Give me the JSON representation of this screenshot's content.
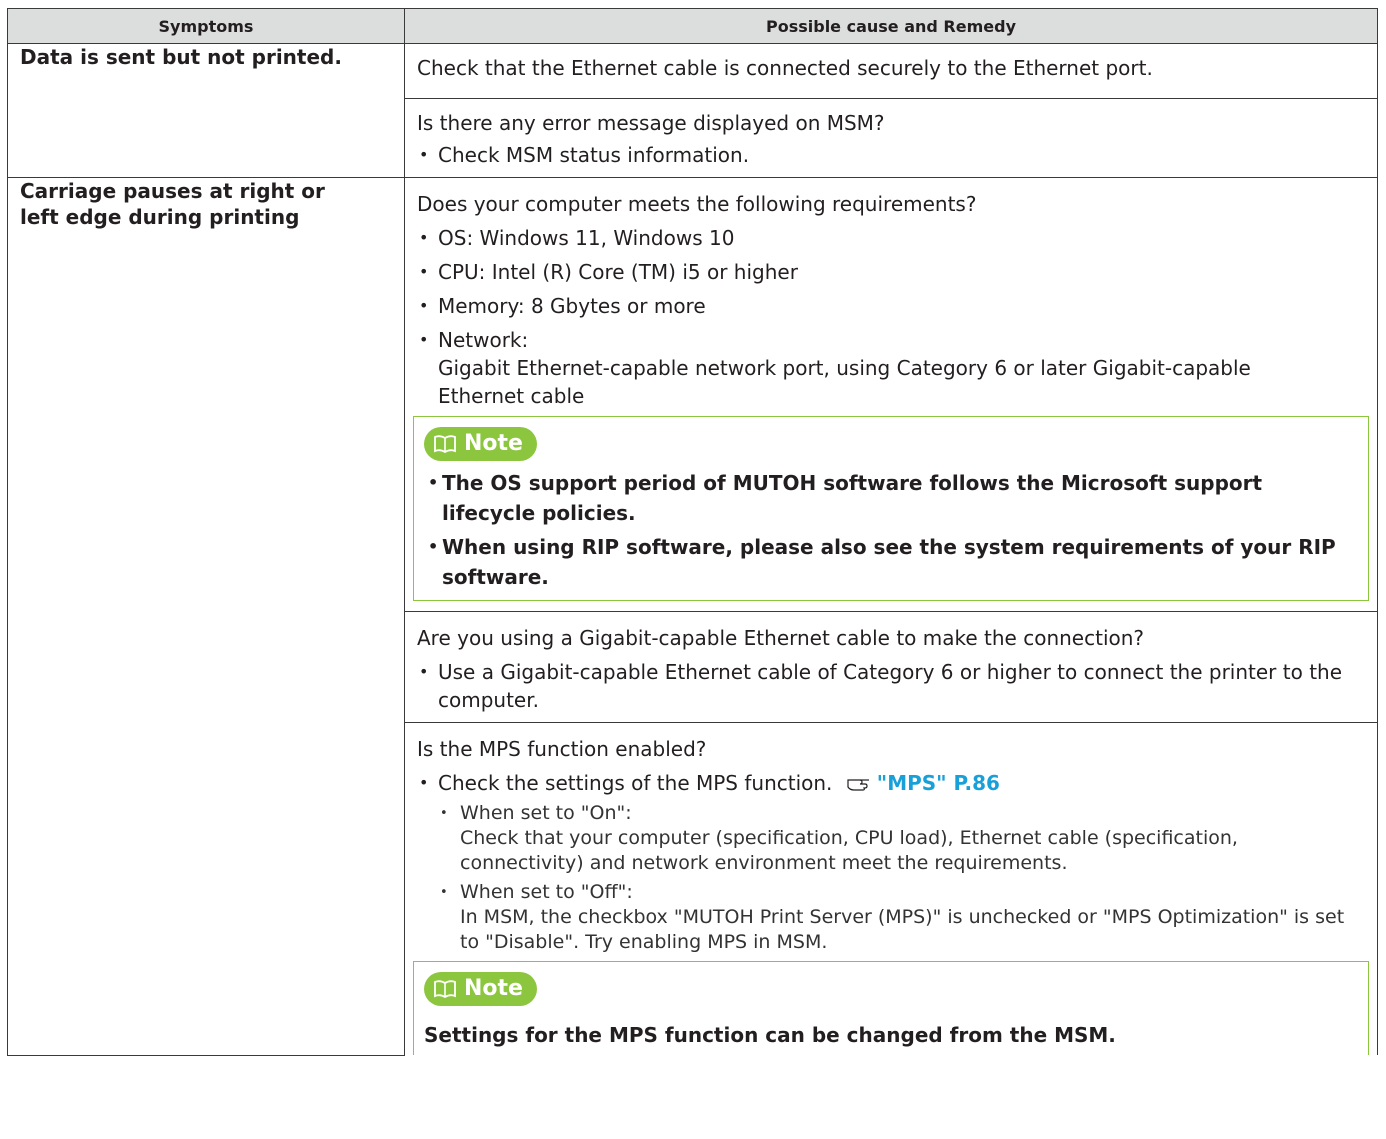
{
  "header": {
    "symptoms": "Symptoms",
    "remedy": "Possible cause and Remedy"
  },
  "rows": [
    {
      "symptom": "Data is sent but not printed.",
      "remedies": [
        {
          "text": "Check that the Ethernet cable is connected securely to the Ethernet port."
        },
        {
          "text": "Is there any error message displayed on MSM?",
          "bullets": [
            "Check MSM status information."
          ]
        }
      ]
    },
    {
      "symptom": "Carriage pauses at right or left edge during printing",
      "remedies": [
        {
          "text": "Does your computer meets the following requirements?",
          "bullets": [
            "OS: Windows 11, Windows 10",
            "CPU: Intel (R) Core (TM) i5 or higher",
            "Memory: 8 Gbytes or more"
          ],
          "network_label": "Network:",
          "network_detail": "Gigabit Ethernet-capable network port, using Category 6 or later Gigabit-capable Ethernet cable",
          "note_label": "Note",
          "note_items": [
            "The OS support period of MUTOH software follows the Microsoft support lifecycle policies.",
            "When using RIP software, please also see the system requirements of your RIP software."
          ]
        },
        {
          "text": "Are you using a Gigabit-capable Ethernet cable to make the connection?",
          "bullets": [
            "Use a Gigabit-capable Ethernet cable of Category 6 or higher to connect the printer to the computer."
          ]
        },
        {
          "text": "Is the MPS function enabled?",
          "check_text": "Check the settings of the MPS function.",
          "link_text": "\"MPS\" P.86",
          "sub": [
            {
              "label": "When set to \"On\":",
              "detail": "Check that your computer (specification, CPU load), Ethernet cable (specification, connectivity) and network environment meet the requirements."
            },
            {
              "label": "When set to \"Off\":",
              "detail": "In MSM, the checkbox \"MUTOH Print Server (MPS)\" is unchecked or \"MPS Optimization\" is set to \"Disable\". Try enabling MPS in MSM."
            }
          ],
          "note_label": "Note",
          "note_text": "Settings for the MPS function can be changed from the MSM."
        }
      ]
    }
  ],
  "colors": {
    "note_green": "#8cc63f",
    "link_blue": "#1aa0d8",
    "header_gray": "#dcdddd"
  }
}
